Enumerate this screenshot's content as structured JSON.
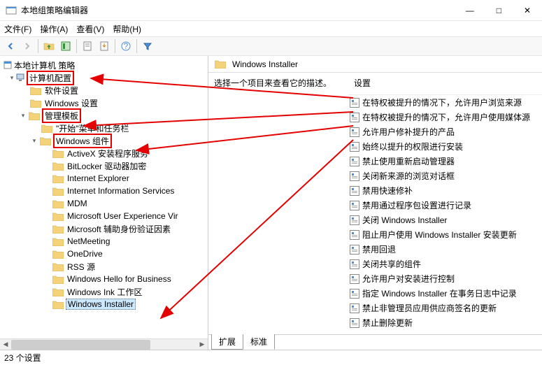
{
  "window": {
    "title": "本地组策略编辑器",
    "controls": {
      "min": "—",
      "max": "□",
      "close": "✕"
    }
  },
  "menu": {
    "file": "文件(F)",
    "action": "操作(A)",
    "view": "查看(V)",
    "help": "帮助(H)"
  },
  "tree": {
    "root": "本地计算机 策略",
    "computer_config": "计算机配置",
    "software": "软件设置",
    "windows_settings": "Windows 设置",
    "admin_templates": "管理模板",
    "start_taskbar": "\"开始\"菜单和任务栏",
    "windows_components": "Windows 组件",
    "items": [
      "ActiveX 安装程序服务",
      "BitLocker 驱动器加密",
      "Internet Explorer",
      "Internet Information Services",
      "MDM",
      "Microsoft User Experience Vir",
      "Microsoft 辅助身份验证因素",
      "NetMeeting",
      "OneDrive",
      "RSS 源",
      "Windows Hello for Business",
      "Windows Ink 工作区",
      "Windows Installer"
    ]
  },
  "content": {
    "header": "Windows Installer",
    "description": "选择一个项目来查看它的描述。",
    "settings_label": "设置",
    "policies": [
      "在特权被提升的情况下，允许用户浏览来源",
      "在特权被提升的情况下，允许用户使用媒体源",
      "允许用户修补提升的产品",
      "始终以提升的权限进行安装",
      "禁止使用重新启动管理器",
      "关闭新来源的浏览对话框",
      "禁用快速修补",
      "禁用通过程序包设置进行记录",
      "关闭 Windows Installer",
      "阻止用户使用 Windows Installer 安装更新",
      "禁用回退",
      "关闭共享的组件",
      "允许用户对安装进行控制",
      "指定 Windows Installer 在事务日志中记录",
      "禁止非管理员应用供应商签名的更新",
      "禁止删除更新"
    ]
  },
  "tabs": {
    "extended": "扩展",
    "standard": "标准"
  },
  "status": "23 个设置"
}
